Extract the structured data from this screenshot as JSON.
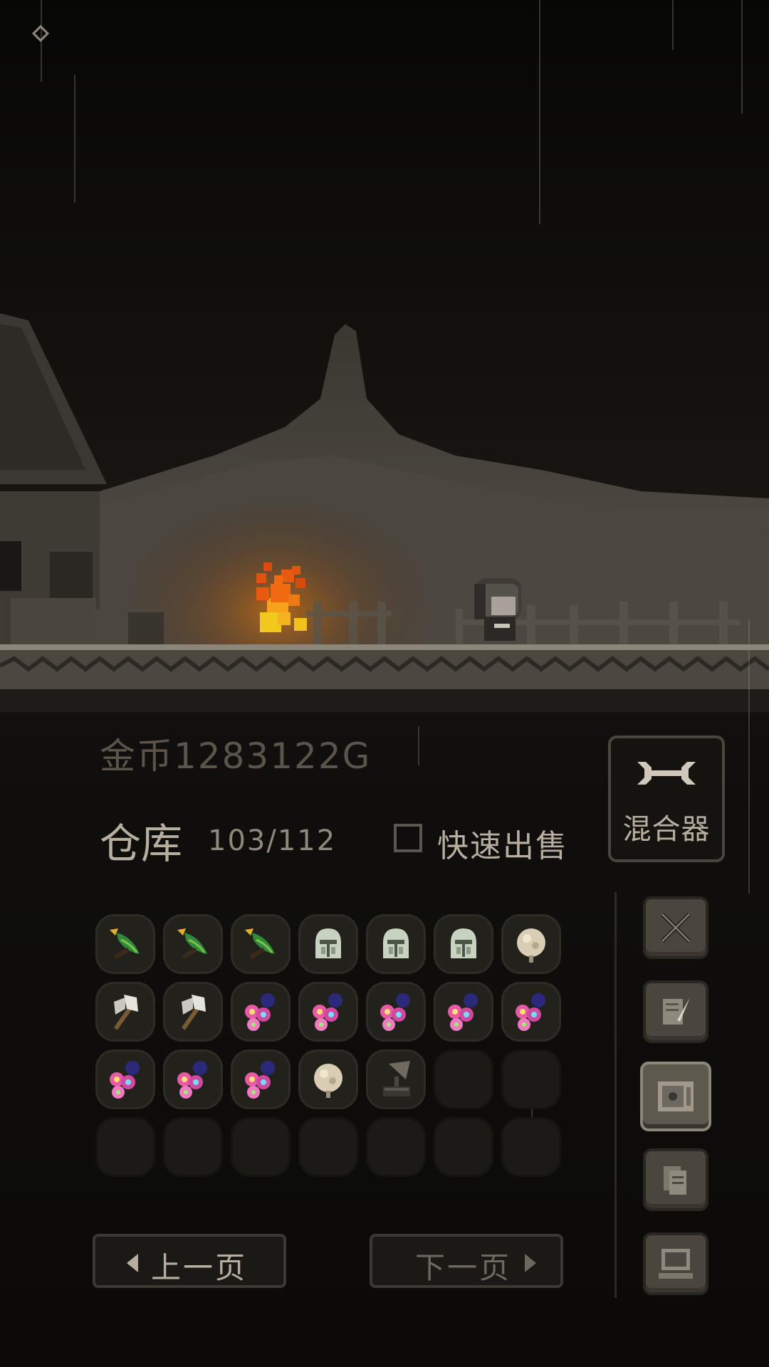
{
  "hud": {
    "gold_label": "金币1283122G"
  },
  "warehouse": {
    "title": "仓库",
    "count": "103/112",
    "quick_sell_label": "快速出售",
    "quick_sell_checked": false
  },
  "mixer": {
    "label": "混合器",
    "icon": "wrench-icon"
  },
  "inventory": {
    "columns": 7,
    "rows": 4,
    "slots": [
      "leaf-dagger-icon",
      "leaf-dagger-icon",
      "leaf-dagger-icon",
      "knight-helmet-icon",
      "knight-helmet-icon",
      "knight-helmet-icon",
      "pale-orb-icon",
      "battle-axe-icon",
      "battle-axe-icon",
      "gem-cluster-icon",
      "gem-cluster-icon",
      "gem-cluster-icon",
      "gem-cluster-icon",
      "gem-cluster-icon",
      "gem-cluster-icon",
      "gem-cluster-icon",
      "gem-cluster-icon",
      "pale-orb-icon",
      "gramophone-icon",
      "empty",
      "empty",
      "empty",
      "empty",
      "empty",
      "empty",
      "empty",
      "empty",
      "empty"
    ]
  },
  "side_menu": [
    {
      "icon": "crossed-swords-icon",
      "active": false
    },
    {
      "icon": "quill-scroll-icon",
      "active": false
    },
    {
      "icon": "safe-box-icon",
      "active": true
    },
    {
      "icon": "documents-icon",
      "active": false
    },
    {
      "icon": "computer-icon",
      "active": false
    }
  ],
  "pagination": {
    "prev_label": "上一页",
    "next_label": "下一页"
  },
  "colors": {
    "fire": "#f06a12",
    "text": "#b7aea0",
    "panel_border": "#4a463e"
  }
}
